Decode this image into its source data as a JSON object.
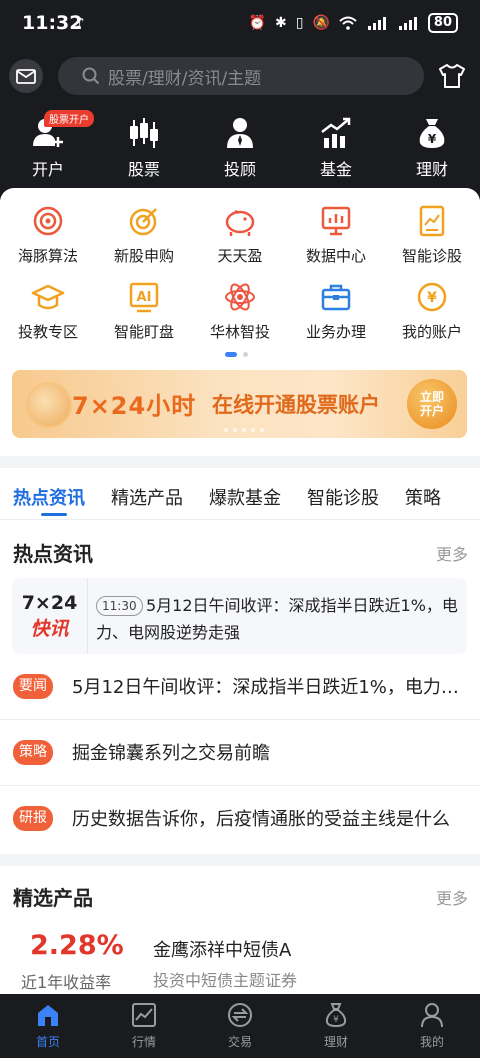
{
  "status_bar": {
    "time": "11:32",
    "battery": "80"
  },
  "search": {
    "placeholder": "股票/理财/资讯/主题"
  },
  "main_nav": [
    {
      "label": "开户",
      "badge": "股票开户",
      "icon": "user-add-icon"
    },
    {
      "label": "股票",
      "icon": "candlestick-icon"
    },
    {
      "label": "投顾",
      "icon": "advisor-icon"
    },
    {
      "label": "基金",
      "icon": "growth-chart-icon"
    },
    {
      "label": "理财",
      "icon": "money-bag-icon"
    }
  ],
  "grid": [
    {
      "label": "海豚算法",
      "icon": "target-icon",
      "color": "#e85a3a"
    },
    {
      "label": "新股申购",
      "icon": "bullseye-icon",
      "color": "#f0a21f"
    },
    {
      "label": "天天盈",
      "icon": "piggy-bank-icon",
      "color": "#ee5540"
    },
    {
      "label": "数据中心",
      "icon": "monitor-chart-icon",
      "color": "#ec5a3b"
    },
    {
      "label": "智能诊股",
      "icon": "report-icon",
      "color": "#f0a21f"
    },
    {
      "label": "投教专区",
      "icon": "graduation-cap-icon",
      "color": "#f0a21f"
    },
    {
      "label": "智能盯盘",
      "icon": "ai-icon",
      "color": "#f0a21f"
    },
    {
      "label": "华林智投",
      "icon": "atom-icon",
      "color": "#ee5540"
    },
    {
      "label": "业务办理",
      "icon": "briefcase-icon",
      "color": "#2f7fe0"
    },
    {
      "label": "我的账户",
      "icon": "yen-coin-icon",
      "color": "#f0a21f"
    }
  ],
  "banner": {
    "title": "7×24小时",
    "subtitle": "在线开通股票账户",
    "button": "立即开户"
  },
  "tabs": [
    "热点资讯",
    "精选产品",
    "爆款基金",
    "智能诊股",
    "策略"
  ],
  "hot_news": {
    "title": "热点资讯",
    "more": "更多",
    "flash": {
      "logo_top": "7×24",
      "logo_bottom": "快讯",
      "time": "11:30",
      "text": "5月12日午间收评：深成指半日跌近1%，电力、电网股逆势走强"
    },
    "items": [
      {
        "tag": "要闻",
        "tag_color": "#f0613a",
        "text": "5月12日午间收评：深成指半日跌近1%，电力、电网股逆势走强"
      },
      {
        "tag": "策略",
        "tag_color": "#f0613a",
        "text": "掘金锦囊系列之交易前瞻"
      },
      {
        "tag": "研报",
        "tag_color": "#f0613a",
        "text": "历史数据告诉你，后疫情通胀的受益主线是什么"
      }
    ]
  },
  "products": {
    "title": "精选产品",
    "more": "更多",
    "rate": "2.28%",
    "rate_label": "近1年收益率",
    "name": "金鹰添祥中短债A",
    "desc": "投资中短债主题证券"
  },
  "bottom_nav": [
    {
      "label": "首页",
      "icon": "home-icon",
      "active": true
    },
    {
      "label": "行情",
      "icon": "market-chart-icon",
      "active": false
    },
    {
      "label": "交易",
      "icon": "trade-icon",
      "active": false
    },
    {
      "label": "理财",
      "icon": "wealth-icon",
      "active": false
    },
    {
      "label": "我的",
      "icon": "profile-icon",
      "active": false
    }
  ]
}
